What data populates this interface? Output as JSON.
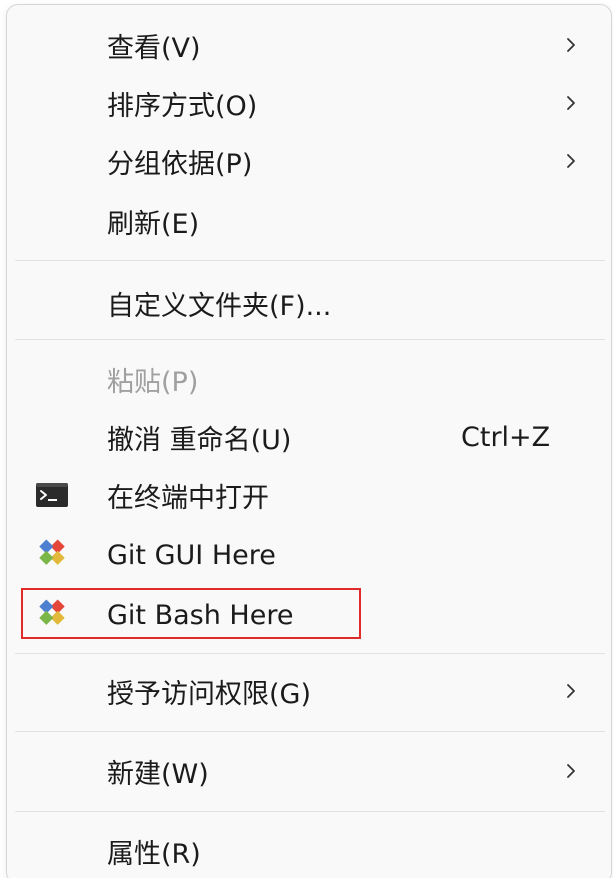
{
  "menu": {
    "items": {
      "view": {
        "label": "查看(V)"
      },
      "sort": {
        "label": "排序方式(O)"
      },
      "group": {
        "label": "分组依据(P)"
      },
      "refresh": {
        "label": "刷新(E)"
      },
      "customize": {
        "label": "自定义文件夹(F)..."
      },
      "paste": {
        "label": "粘贴(P)"
      },
      "undo": {
        "label": "撤消 重命名(U)",
        "shortcut": "Ctrl+Z"
      },
      "terminal": {
        "label": "在终端中打开",
        "icon": "terminal-icon"
      },
      "git_gui": {
        "label": "Git GUI Here",
        "icon": "git-icon"
      },
      "git_bash": {
        "label": "Git Bash Here",
        "icon": "git-icon"
      },
      "access": {
        "label": "授予访问权限(G)"
      },
      "new": {
        "label": "新建(W)"
      },
      "properties": {
        "label": "属性(R)"
      }
    }
  },
  "colors": {
    "highlight_border": "#e02b2b",
    "disabled_text": "#a0a0a0",
    "menu_background": "#f9f9f9"
  }
}
